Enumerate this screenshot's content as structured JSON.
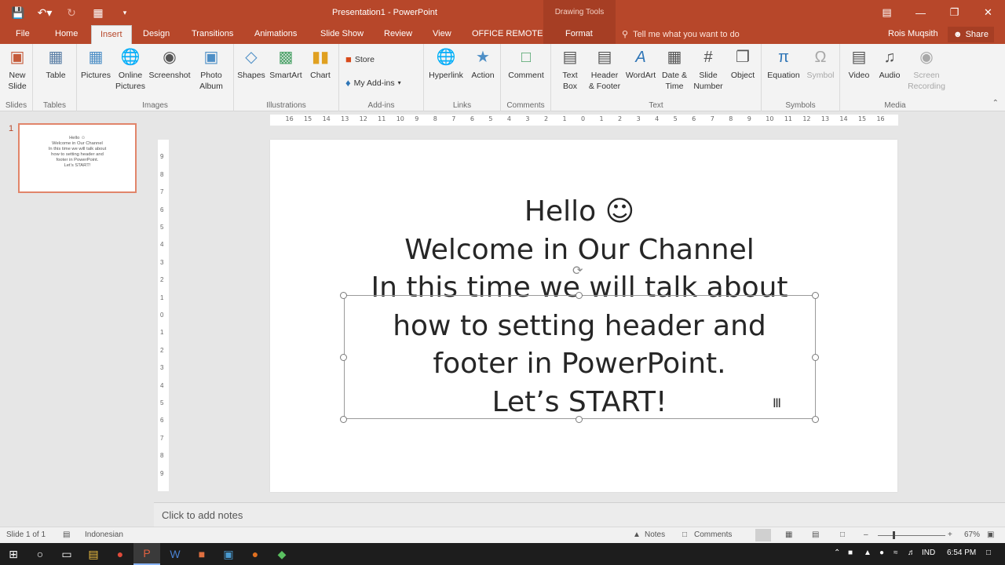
{
  "app": {
    "title": "Presentation1 - PowerPoint",
    "contextual_tools_label": "Drawing Tools",
    "user": "Rois Muqsith",
    "share_label": "Share",
    "tell_me": "Tell me what you want to do"
  },
  "tabs": {
    "file": "File",
    "home": "Home",
    "insert": "Insert",
    "design": "Design",
    "transitions": "Transitions",
    "animations": "Animations",
    "slideshow": "Slide Show",
    "review": "Review",
    "view": "View",
    "office_remote": "OFFICE REMOTE",
    "format": "Format",
    "active": "Insert"
  },
  "ribbon": {
    "groups": {
      "slides": "Slides",
      "tables": "Tables",
      "images": "Images",
      "illustrations": "Illustrations",
      "addins": "Add-ins",
      "links": "Links",
      "comments": "Comments",
      "text": "Text",
      "symbols": "Symbols",
      "media": "Media"
    },
    "buttons": {
      "new_slide": "New\nSlide",
      "table": "Table",
      "pictures": "Pictures",
      "online_pictures": "Online\nPictures",
      "screenshot": "Screenshot",
      "photo_album": "Photo\nAlbum",
      "shapes": "Shapes",
      "smartart": "SmartArt",
      "chart": "Chart",
      "store": "Store",
      "my_addins": "My Add-ins",
      "hyperlink": "Hyperlink",
      "action": "Action",
      "comment": "Comment",
      "text_box": "Text\nBox",
      "header_footer": "Header\n& Footer",
      "wordart": "WordArt",
      "date_time": "Date &\nTime",
      "slide_number": "Slide\nNumber",
      "object": "Object",
      "equation": "Equation",
      "symbol": "Symbol",
      "video": "Video",
      "audio": "Audio",
      "screen_recording": "Screen\nRecording"
    }
  },
  "thumbnails": [
    {
      "number": "1",
      "text": "Hello ☺\nWelcome in Our Channel\nIn this time we will talk about\nhow to setting header and\nfooter in PowerPoint.\nLet’s START!"
    }
  ],
  "slide": {
    "lines": [
      "Hello ☺",
      "Welcome in Our Channel",
      "In this time we will talk about",
      "how to setting header and",
      "footer in PowerPoint.",
      "Let’s START!"
    ]
  },
  "ruler": {
    "horizontal": [
      "16",
      "15",
      "14",
      "13",
      "12",
      "11",
      "10",
      "9",
      "8",
      "7",
      "6",
      "5",
      "4",
      "3",
      "2",
      "1",
      "0",
      "1",
      "2",
      "3",
      "4",
      "5",
      "6",
      "7",
      "8",
      "9",
      "10",
      "11",
      "12",
      "13",
      "14",
      "15",
      "16"
    ],
    "vertical": [
      "9",
      "8",
      "7",
      "6",
      "5",
      "4",
      "3",
      "2",
      "1",
      "0",
      "1",
      "2",
      "3",
      "4",
      "5",
      "6",
      "7",
      "8",
      "9"
    ]
  },
  "notes": {
    "placeholder": "Click to add notes"
  },
  "status": {
    "slide_of": "Slide 1 of 1",
    "language": "Indonesian",
    "notes": "Notes",
    "comments": "Comments",
    "zoom": "67%"
  },
  "taskbar": {
    "lang": "IND",
    "time": "6:54 PM"
  },
  "colors": {
    "accent": "#b7472a",
    "ribbon_bg": "#f3f3f3",
    "workspace_bg": "#e6e6e6"
  }
}
